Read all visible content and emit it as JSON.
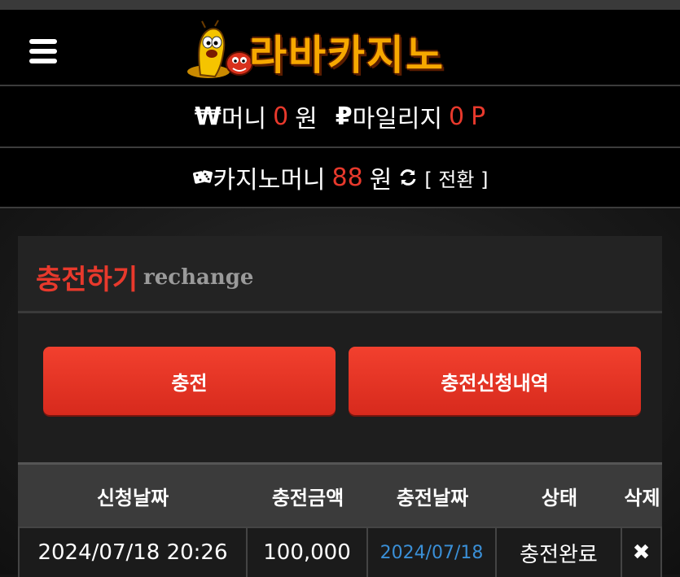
{
  "header": {
    "menu_icon": "hamburger-menu-icon",
    "logo_text": "라바카지노",
    "logo_mascot_icon": "larva-mascot-icon"
  },
  "balances": {
    "money_symbol": "₩",
    "money_label": "머니",
    "money_value": "0",
    "money_unit": "원",
    "mileage_symbol": "₽",
    "mileage_label": "마일리지",
    "mileage_value": "0",
    "mileage_unit": "P",
    "casino_icon": "dice-icon",
    "casino_label": "카지노머니",
    "casino_value": "88",
    "casino_unit": "원",
    "refresh_icon": "refresh-icon",
    "convert_label": "[ 전환 ]"
  },
  "section": {
    "title_kr": "충전하기",
    "title_en": "rechange"
  },
  "buttons": {
    "charge": "충전",
    "history": "충전신청내역"
  },
  "table": {
    "headers": [
      "신청날짜",
      "충전금액",
      "충전날짜",
      "상태",
      "삭제"
    ],
    "rows": [
      {
        "request_date": "2024/07/18 20:26",
        "amount": "100,000",
        "charge_date": "2024/07/18",
        "status": "충전완료",
        "delete": "✖"
      }
    ]
  },
  "colors": {
    "accent_red": "#e8392c",
    "link_blue": "#3a8fd6",
    "logo_orange": "#f7a800"
  }
}
